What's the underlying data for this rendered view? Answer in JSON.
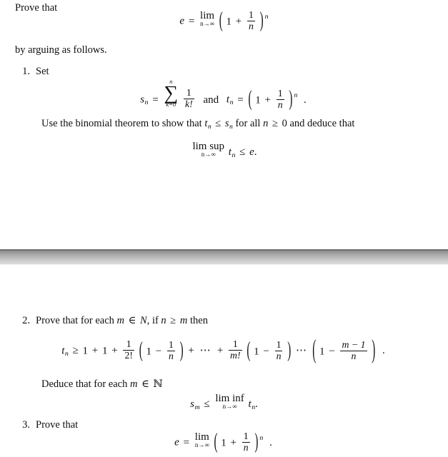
{
  "document": {
    "type": "math-exercise",
    "background_color": "#ffffff",
    "text_color": "#101010"
  },
  "intro": {
    "lead": "Prove that",
    "after": "by arguing as follows."
  },
  "formula_intro": {
    "label": "e-limit-definition",
    "latex": "e = \\lim_{n \\to \\infty} \\left(1 + \\frac{1}{n}\\right)^n",
    "parts": {
      "lhs": "e",
      "equals": "=",
      "lim": "lim",
      "lim_sub": "n→∞",
      "one": "1",
      "plus": "+",
      "frac_num": "1",
      "frac_den": "n",
      "exponent": "n",
      "paren_open": "(",
      "paren_close": ")"
    }
  },
  "items": [
    {
      "number": "1.",
      "text": "Set",
      "formula": {
        "label": "sn-tn-definition",
        "latex": "s_n = \\sum_{k=0}^{n} \\frac{1}{k!} \\text{ and } t_n = \\left(1 + \\frac{1}{n}\\right)^n .",
        "parts": {
          "s": "s",
          "s_sub": "n",
          "equals": "=",
          "sum_glyph": "∑",
          "sum_upper": "n",
          "sum_lower": "k=0",
          "frac_num": "1",
          "frac_den": "k!",
          "and": "and",
          "t": "t",
          "t_sub": "n",
          "one": "1",
          "plus": "+",
          "frac2_num": "1",
          "frac2_den": "n",
          "exponent": "n",
          "paren_open": "(",
          "paren_close": ")",
          "period": "."
        }
      },
      "text_after": "Use the binomial theorem to show that",
      "text_after_2": "for all",
      "text_after_3": "and deduce that",
      "inline_math_1": {
        "t": "t",
        "t_sub": "n",
        "leq": "≤",
        "s": "s",
        "s_sub": "n"
      },
      "inline_math_2": {
        "n": "n",
        "geq": "≥",
        "zero": "0"
      },
      "formula_2": {
        "label": "limsup-tn-leq-e",
        "latex": "\\limsup_{n \\to \\infty} t_n \\le e.",
        "parts": {
          "limsup": "lim sup",
          "lim_sub": "n→∞",
          "t": "t",
          "t_sub": "n",
          "leq": "≤",
          "e": "e",
          "period": "."
        }
      }
    },
    {
      "number": "2.",
      "text_a": "Prove that for each",
      "text_b": "if",
      "text_c": "then",
      "inline_m_in_N": {
        "m": "m",
        "in": "∈",
        "N": "N"
      },
      "inline_n_geq_m": {
        "n": "n",
        "geq": "≥",
        "m": "m"
      },
      "formula": {
        "label": "tn-lower-bound-product",
        "latex": "t_n \\ge 1 + 1 + \\frac{1}{2!}\\left(1-\\frac{1}{n}\\right) + \\cdots + \\frac{1}{m!}\\left(1-\\frac{1}{n}\\right)\\cdots\\left(1-\\frac{m-1}{n}\\right).",
        "parts": {
          "t": "t",
          "t_sub": "n",
          "geq": "≥",
          "one": "1",
          "plus": "+",
          "frac_2fact_num": "1",
          "frac_2fact_den": "2!",
          "minus": "−",
          "frac_1n_num": "1",
          "frac_1n_den": "n",
          "cdots": "⋯",
          "frac_mfact_num": "1",
          "frac_mfact_den": "m!",
          "frac_m1n_num": "m − 1",
          "frac_m1n_den": "n",
          "paren_open": "(",
          "paren_close": ")",
          "period": "."
        }
      },
      "deduce_text": "Deduce that for each",
      "deduce_symbol": {
        "m": "m",
        "in": "∈",
        "N": "ℕ"
      },
      "formula_2": {
        "label": "sm-leq-liminf-tn",
        "latex": "s_m \\le \\liminf_{n \\to \\infty} t_n.",
        "parts": {
          "s": "s",
          "s_sub": "m",
          "leq": "≤",
          "liminf": "lim inf",
          "lim_sub": "n→∞",
          "t": "t",
          "t_sub": "n",
          "period": "."
        }
      }
    },
    {
      "number": "3.",
      "text": "Prove that",
      "formula": {
        "label": "e-limit-conclusion",
        "latex": "e = \\lim_{n\\to\\infty}\\left(1+\\frac{1}{n}\\right)^n .",
        "parts": {
          "lhs": "e",
          "equals": "=",
          "lim": "lim",
          "lim_sub": "n→∞",
          "one": "1",
          "plus": "+",
          "frac_num": "1",
          "frac_den": "n",
          "exponent": "n",
          "paren_open": "(",
          "paren_close": ")",
          "period": "."
        }
      }
    }
  ],
  "divider": {
    "label": "page-break-divider",
    "top_line_color": "#6f6f6f",
    "gradient_from": "#8b8b8b",
    "gradient_to": "#dedede"
  }
}
